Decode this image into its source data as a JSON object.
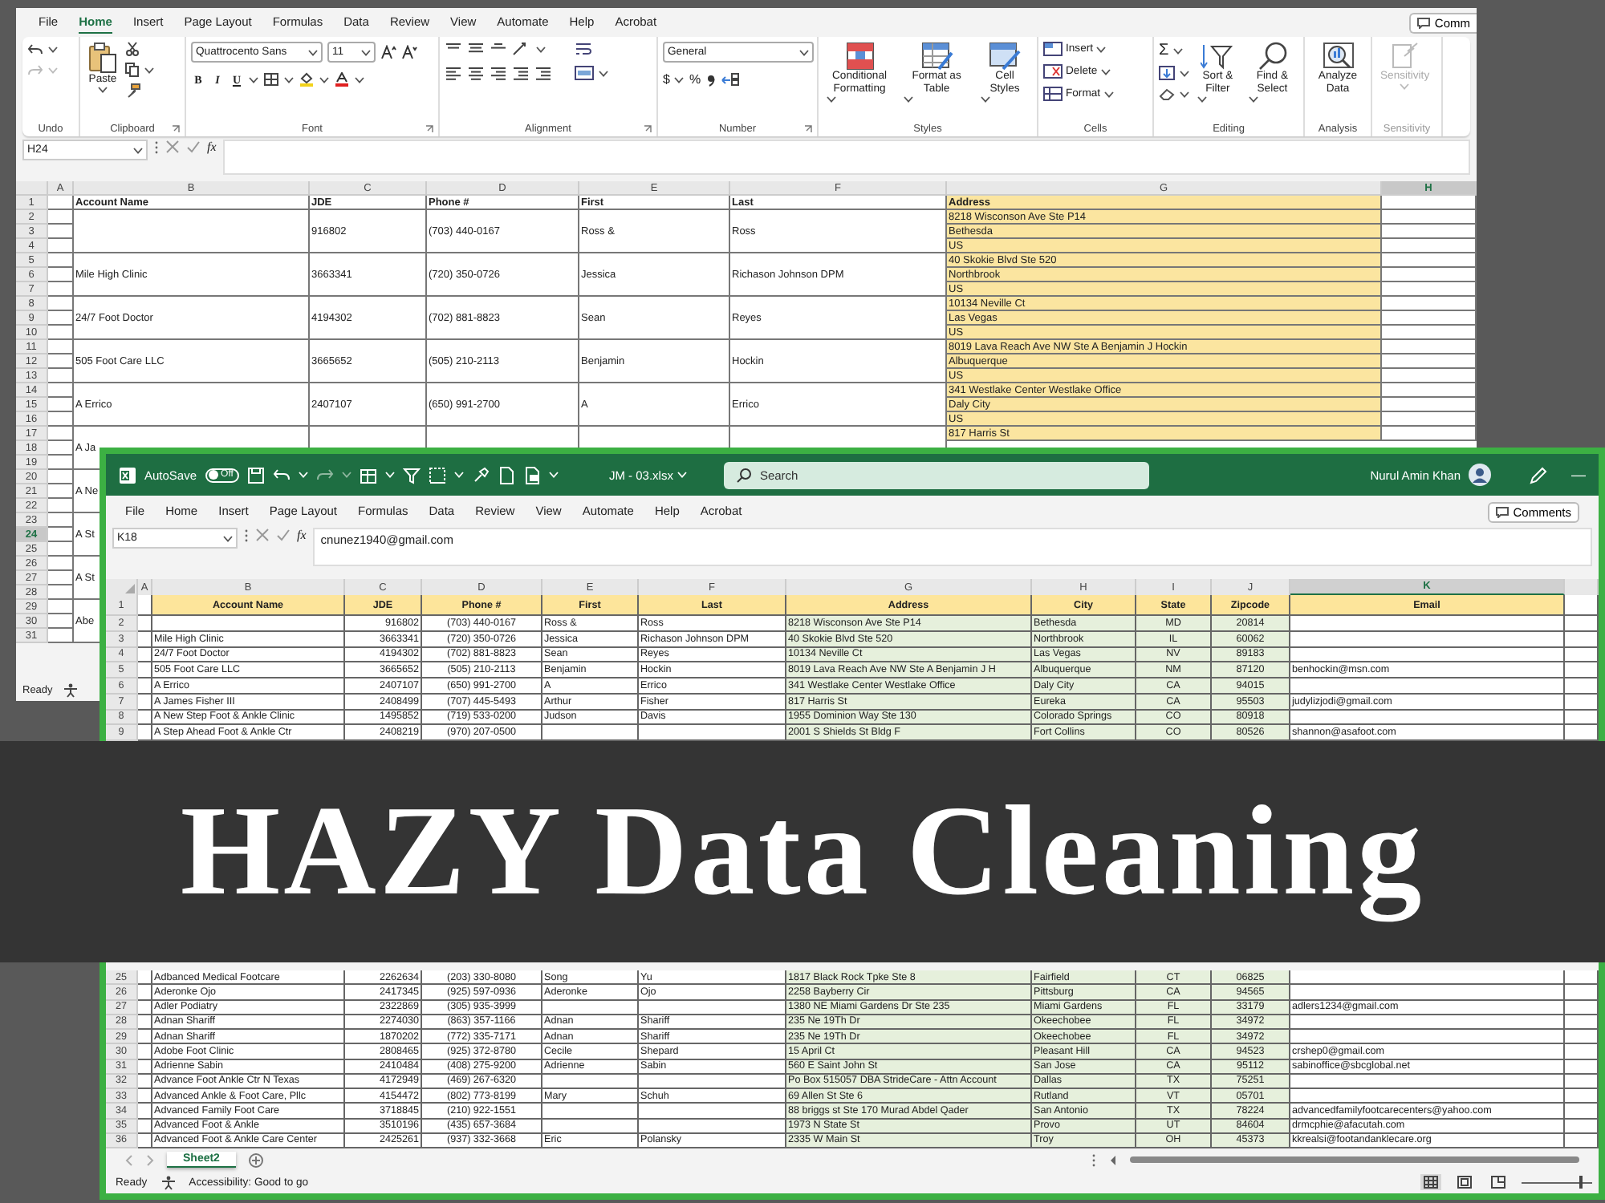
{
  "back_window": {
    "menu_tabs": [
      {
        "label": "File",
        "selected": false
      },
      {
        "label": "Home",
        "selected": true
      },
      {
        "label": "Insert",
        "selected": false
      },
      {
        "label": "Page Layout",
        "selected": false
      },
      {
        "label": "Formulas",
        "selected": false
      },
      {
        "label": "Data",
        "selected": false
      },
      {
        "label": "Review",
        "selected": false
      },
      {
        "label": "View",
        "selected": false
      },
      {
        "label": "Automate",
        "selected": false
      },
      {
        "label": "Help",
        "selected": false
      },
      {
        "label": "Acrobat",
        "selected": false
      }
    ],
    "comments_button": "Comm",
    "ribbon": [
      {
        "kind": "undo",
        "label": "Undo"
      },
      {
        "kind": "clipboard",
        "label": "Clipboard",
        "launcher": true,
        "buttons": [
          "Paste"
        ]
      },
      {
        "kind": "font",
        "label": "Font",
        "launcher": true,
        "font": "Quattrocento Sans",
        "size": "11",
        "buttons": [
          "B",
          "I",
          "U"
        ]
      },
      {
        "kind": "alignment",
        "label": "Alignment",
        "launcher": true
      },
      {
        "kind": "number",
        "label": "Number",
        "launcher": true,
        "format": "General",
        "buttons": [
          "$",
          "%"
        ]
      },
      {
        "kind": "styles",
        "label": "Styles",
        "buttons": [
          "Conditional Formatting",
          "Format as Table",
          "Cell Styles"
        ]
      },
      {
        "kind": "cells",
        "label": "Cells",
        "buttons": [
          "Insert",
          "Delete",
          "Format"
        ]
      },
      {
        "kind": "editing",
        "label": "Editing",
        "sum": "Σ",
        "buttons": [
          "Sort & Filter",
          "Find & Select"
        ]
      },
      {
        "kind": "analysis",
        "label": "Analysis",
        "buttons": [
          "Analyze Data"
        ]
      },
      {
        "kind": "sensitivity",
        "label": "Sensitivity",
        "disabled": true,
        "buttons": [
          "Sensitivity"
        ]
      }
    ],
    "formula_bar": {
      "name_box": "H24",
      "fx": "fx"
    },
    "grid": {
      "columns": [
        {
          "label": "A",
          "selected": false
        },
        {
          "label": "B",
          "selected": false
        },
        {
          "label": "C",
          "selected": false
        },
        {
          "label": "D",
          "selected": false
        },
        {
          "label": "E",
          "selected": false
        },
        {
          "label": "F",
          "selected": false
        },
        {
          "label": "G",
          "selected": false
        },
        {
          "label": "H",
          "selected": true
        }
      ],
      "row_numbers": [
        {
          "number": "1",
          "selected": false
        },
        {
          "number": "2",
          "selected": false
        },
        {
          "number": "3",
          "selected": false
        },
        {
          "number": "4",
          "selected": false
        },
        {
          "number": "5",
          "selected": false
        },
        {
          "number": "6",
          "selected": false
        },
        {
          "number": "7",
          "selected": false
        },
        {
          "number": "8",
          "selected": false
        },
        {
          "number": "9",
          "selected": false
        },
        {
          "number": "10",
          "selected": false
        },
        {
          "number": "11",
          "selected": false
        },
        {
          "number": "12",
          "selected": false
        },
        {
          "number": "13",
          "selected": false
        },
        {
          "number": "14",
          "selected": false
        },
        {
          "number": "15",
          "selected": false
        },
        {
          "number": "16",
          "selected": false
        },
        {
          "number": "17",
          "selected": false
        },
        {
          "number": "18",
          "selected": false
        },
        {
          "number": "19",
          "selected": false
        },
        {
          "number": "20",
          "selected": false
        },
        {
          "number": "21",
          "selected": false
        },
        {
          "number": "22",
          "selected": false
        },
        {
          "number": "23",
          "selected": false
        },
        {
          "number": "24",
          "selected": true
        },
        {
          "number": "25",
          "selected": false
        },
        {
          "number": "26",
          "selected": false
        },
        {
          "number": "27",
          "selected": false
        },
        {
          "number": "28",
          "selected": false
        },
        {
          "number": "29",
          "selected": false
        },
        {
          "number": "30",
          "selected": false
        },
        {
          "number": "31",
          "selected": false
        }
      ],
      "headings": [
        "Account Name",
        "JDE",
        "Phone #",
        "First",
        "Last",
        "Address"
      ],
      "records": [
        {
          "jde": "916802",
          "phone": "(703) 440-0167",
          "first": "Ross &",
          "last": "Ross",
          "address_lines": [
            "8218 Wisconson Ave Ste P14",
            "Bethesda",
            "US"
          ]
        },
        {
          "account": "Mile High Clinic",
          "jde": "3663341",
          "phone": "(720) 350-0726",
          "first": "Jessica",
          "last": "Richason Johnson DPM",
          "address_lines": [
            "40 Skokie Blvd Ste 520",
            "Northbrook",
            "US"
          ]
        },
        {
          "account": "24/7 Foot Doctor",
          "jde": "4194302",
          "phone": "(702) 881-8823",
          "first": "Sean",
          "last": "Reyes",
          "address_lines": [
            "10134 Neville Ct",
            "Las Vegas",
            "US"
          ]
        },
        {
          "account": "505 Foot Care LLC",
          "jde": "3665652",
          "phone": "(505) 210-2113",
          "first": "Benjamin",
          "last": "Hockin",
          "address_lines": [
            "8019 Lava Reach Ave NW Ste A Benjamin J Hockin",
            "Albuquerque",
            "US"
          ]
        },
        {
          "account": "A Errico",
          "jde": "2407107",
          "phone": "(650) 991-2700",
          "first": "A",
          "last": "Errico",
          "address_lines": [
            "341 Westlake Center Westlake Office",
            "Daly City",
            "US"
          ]
        },
        {
          "account": "A Ja",
          "address_lines": [
            "817 Harris St"
          ]
        },
        {
          "account": "A Ne"
        },
        {
          "account": "A St"
        },
        {
          "account": "A St"
        },
        {
          "account": "Abe"
        }
      ]
    },
    "status": "Ready"
  },
  "front_window": {
    "title_bar": {
      "autosave": "AutoSave",
      "autosave_toggle": {
        "label": "Off",
        "on": false
      },
      "file_name": "JM - 03.xlsx",
      "search_placeholder": "Search",
      "user_name": "Nurul Amin Khan",
      "minimize": "—"
    },
    "menu_tabs": [
      {
        "label": "File",
        "selected": false
      },
      {
        "label": "Home",
        "selected": false
      },
      {
        "label": "Insert",
        "selected": false
      },
      {
        "label": "Page Layout",
        "selected": false
      },
      {
        "label": "Formulas",
        "selected": false
      },
      {
        "label": "Data",
        "selected": false
      },
      {
        "label": "Review",
        "selected": false
      },
      {
        "label": "View",
        "selected": false
      },
      {
        "label": "Automate",
        "selected": false
      },
      {
        "label": "Help",
        "selected": false
      },
      {
        "label": "Acrobat",
        "selected": false
      }
    ],
    "comments_button": "Comments",
    "formula_bar": {
      "name_box": "K18",
      "fx": "fx",
      "value": "cnunez1940@gmail.com"
    },
    "columns": [
      {
        "label": "A",
        "selected": false
      },
      {
        "label": "B",
        "selected": false
      },
      {
        "label": "C",
        "selected": false
      },
      {
        "label": "D",
        "selected": false
      },
      {
        "label": "E",
        "selected": false
      },
      {
        "label": "F",
        "selected": false
      },
      {
        "label": "G",
        "selected": false
      },
      {
        "label": "H",
        "selected": false
      },
      {
        "label": "I",
        "selected": false
      },
      {
        "label": "J",
        "selected": false
      },
      {
        "label": "K",
        "selected": true
      }
    ],
    "header_row": {
      "number": "1",
      "headings": [
        "Account Name",
        "JDE",
        "Phone #",
        "First",
        "Last",
        "Address",
        "City",
        "State",
        "Zipcode",
        "Email"
      ]
    },
    "rows_top": [
      {
        "number": "2",
        "jde": "916802",
        "phone": "(703) 440-0167",
        "first": "Ross &",
        "last": "Ross",
        "address": "8218 Wisconson Ave Ste P14",
        "city": "Bethesda",
        "state": "MD",
        "zipcode": "20814"
      },
      {
        "number": "3",
        "account_name": "Mile High Clinic",
        "jde": "3663341",
        "phone": "(720) 350-0726",
        "first": "Jessica",
        "last": "Richason Johnson DPM",
        "address": "40 Skokie Blvd Ste 520",
        "city": "Northbrook",
        "state": "IL",
        "zipcode": "60062"
      },
      {
        "number": "4",
        "account_name": "24/7 Foot Doctor",
        "jde": "4194302",
        "phone": "(702) 881-8823",
        "first": "Sean",
        "last": "Reyes",
        "address": "10134 Neville Ct",
        "city": "Las Vegas",
        "state": "NV",
        "zipcode": "89183"
      },
      {
        "number": "5",
        "account_name": "505 Foot Care LLC",
        "jde": "3665652",
        "phone": "(505) 210-2113",
        "first": "Benjamin",
        "last": "Hockin",
        "address": "8019 Lava Reach Ave NW Ste A Benjamin J H",
        "city": "Albuquerque",
        "state": "NM",
        "zipcode": "87120",
        "email": "benhockin@msn.com"
      },
      {
        "number": "6",
        "account_name": "A Errico",
        "jde": "2407107",
        "phone": "(650) 991-2700",
        "first": "A",
        "last": "Errico",
        "address": "341 Westlake Center Westlake Office",
        "city": "Daly City",
        "state": "CA",
        "zipcode": "94015"
      },
      {
        "number": "7",
        "account_name": "A James Fisher III",
        "jde": "2408499",
        "phone": "(707) 445-5493",
        "first": "Arthur",
        "last": "Fisher",
        "address": "817 Harris St",
        "city": "Eureka",
        "state": "CA",
        "zipcode": "95503",
        "email": "judylizjodi@gmail.com"
      },
      {
        "number": "8",
        "account_name": "A New Step Foot & Ankle Clinic",
        "jde": "1495852",
        "phone": "(719) 533-0200",
        "first": "Judson",
        "last": "Davis",
        "address": "1955 Dominion Way Ste 130",
        "city": "Colorado Springs",
        "state": "CO",
        "zipcode": "80918"
      },
      {
        "number": "9",
        "account_name": "A Step Ahead Foot & Ankle Ctr",
        "jde": "2408219",
        "phone": "(970) 207-0500",
        "address": "2001 S Shields St Bldg F",
        "city": "Fort Collins",
        "state": "CO",
        "zipcode": "80526",
        "email": "shannon@asafoot.com"
      }
    ],
    "rows_bottom": [
      {
        "number": "25",
        "account_name": "Adbanced Medical Footcare",
        "jde": "2262634",
        "phone": "(203) 330-8080",
        "first": "Song",
        "last": "Yu",
        "address": "1817 Black Rock Tpke Ste 8",
        "city": "Fairfield",
        "state": "CT",
        "zipcode": "06825"
      },
      {
        "number": "26",
        "account_name": "Aderonke Ojo",
        "jde": "2417345",
        "phone": "(925) 597-0936",
        "first": "Aderonke",
        "last": "Ojo",
        "address": "2258 Bayberry Cir",
        "city": "Pittsburg",
        "state": "CA",
        "zipcode": "94565"
      },
      {
        "number": "27",
        "account_name": "Adler Podiatry",
        "jde": "2322869",
        "phone": "(305) 935-3999",
        "address": "1380 NE Miami Gardens Dr Ste 235",
        "city": "Miami Gardens",
        "state": "FL",
        "zipcode": "33179",
        "email": "adlers1234@gmail.com"
      },
      {
        "number": "28",
        "account_name": "Adnan Shariff",
        "jde": "2274030",
        "phone": "(863) 357-1166",
        "first": "Adnan",
        "last": "Shariff",
        "address": "235 Ne 19Th Dr",
        "city": "Okeechobee",
        "state": "FL",
        "zipcode": "34972"
      },
      {
        "number": "29",
        "account_name": "Adnan Shariff",
        "jde": "1870202",
        "phone": "(772) 335-7171",
        "first": "Adnan",
        "last": "Shariff",
        "address": "235 Ne 19Th Dr",
        "city": "Okeechobee",
        "state": "FL",
        "zipcode": "34972"
      },
      {
        "number": "30",
        "account_name": "Adobe Foot Clinic",
        "jde": "2808465",
        "phone": "(925) 372-8780",
        "first": "Cecile",
        "last": "Shepard",
        "address": "15 April Ct",
        "city": "Pleasant Hill",
        "state": "CA",
        "zipcode": "94523",
        "email": "crshep0@gmail.com"
      },
      {
        "number": "31",
        "account_name": "Adrienne Sabin",
        "jde": "2410484",
        "phone": "(408) 275-9200",
        "first": "Adrienne",
        "last": "Sabin",
        "address": "560 E Saint John St",
        "city": "San Jose",
        "state": "CA",
        "zipcode": "95112",
        "email": "sabinoffice@sbcglobal.net"
      },
      {
        "number": "32",
        "account_name": "Advance Foot Ankle Ctr N Texas",
        "jde": "4172949",
        "phone": "(469) 267-6320",
        "address": "Po Box 515057 DBA StrideCare - Attn Account",
        "city": "Dallas",
        "state": "TX",
        "zipcode": "75251"
      },
      {
        "number": "33",
        "account_name": "Advanced Ankle & Foot Care, Pllc",
        "jde": "4154472",
        "phone": "(802) 773-8199",
        "first": "Mary",
        "last": "Schuh",
        "address": "69 Allen St Ste 6",
        "city": "Rutland",
        "state": "VT",
        "zipcode": "05701"
      },
      {
        "number": "34",
        "account_name": "Advanced Family Foot Care",
        "jde": "3718845",
        "phone": "(210) 922-1551",
        "address": "88 briggs st Ste 170 Murad Abdel Qader",
        "city": "San Antonio",
        "state": "TX",
        "zipcode": "78224",
        "email": "advancedfamilyfootcarecenters@yahoo.com"
      },
      {
        "number": "35",
        "account_name": "Advanced Foot & Ankle",
        "jde": "3510196",
        "phone": "(435) 657-3684",
        "address": "1973 N State St",
        "city": "Provo",
        "state": "UT",
        "zipcode": "84604",
        "email": "drmcphie@afacutah.com"
      },
      {
        "number": "36",
        "account_name": "Advanced Foot & Ankle Care Center",
        "jde": "2425261",
        "phone": "(937) 332-3668",
        "first": "Eric",
        "last": "Polansky",
        "address": "2335 W Main St",
        "city": "Troy",
        "state": "OH",
        "zipcode": "45373",
        "email": "kkrealsi@footandanklecare.org"
      }
    ],
    "sheet_tabs": [
      {
        "label": "Sheet2",
        "selected": true
      }
    ],
    "status": {
      "text": "Ready",
      "accessibility": "Accessibility: Good to go",
      "views": [
        {
          "kind": "normal",
          "selected": true
        },
        {
          "kind": "page_layout",
          "selected": false
        },
        {
          "kind": "page_break",
          "selected": false
        }
      ],
      "zoom": {
        "level": 0.85
      }
    }
  },
  "banner": {
    "title": "HAZY Data Cleaning"
  }
}
